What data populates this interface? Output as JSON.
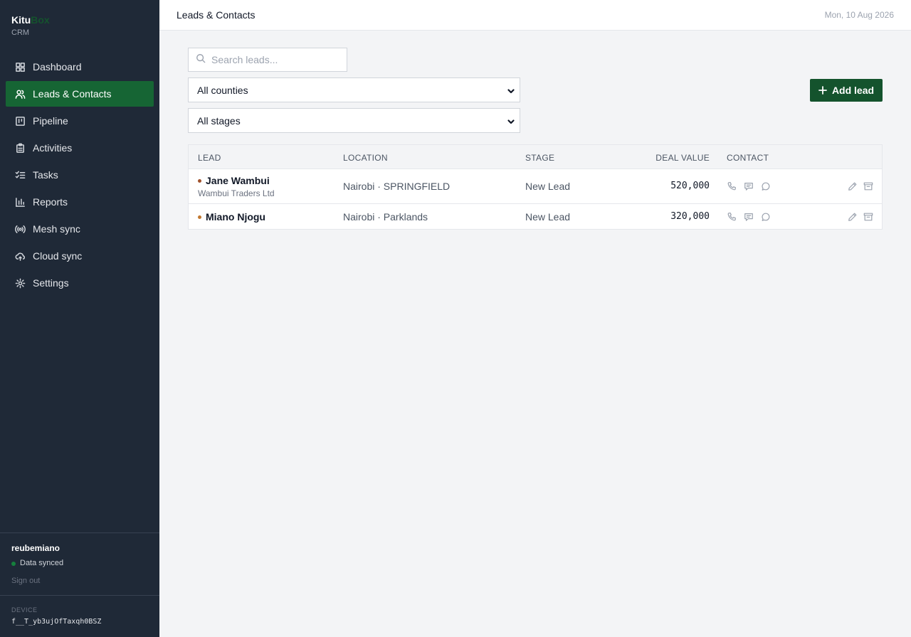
{
  "app": {
    "brand_part1": "Kitu",
    "brand_part2": "Box",
    "brand_sub": "CRM"
  },
  "sidebar": {
    "items": [
      {
        "label": "Dashboard",
        "icon": "grid-icon"
      },
      {
        "label": "Leads & Contacts",
        "icon": "users-icon",
        "active": true
      },
      {
        "label": "Pipeline",
        "icon": "kanban-icon"
      },
      {
        "label": "Activities",
        "icon": "clipboard-icon"
      },
      {
        "label": "Tasks",
        "icon": "checklist-icon"
      },
      {
        "label": "Reports",
        "icon": "bar-chart-icon"
      },
      {
        "label": "Mesh sync",
        "icon": "broadcast-icon"
      },
      {
        "label": "Cloud sync",
        "icon": "cloud-sync-icon"
      },
      {
        "label": "Settings",
        "icon": "gear-icon"
      }
    ],
    "user": {
      "name": "reubemiano",
      "status": "Data synced",
      "sign_out": "Sign out"
    },
    "device": {
      "label": "DEVICE",
      "id": "f__T_yb3ujOfTaxqh0BSZ"
    }
  },
  "header": {
    "title": "Leads & Contacts",
    "date": "Mon, 10 Aug 2026"
  },
  "filters": {
    "search_placeholder": "Search leads...",
    "county_selected": "All counties",
    "stage_selected": "All stages",
    "add_lead_label": "Add lead"
  },
  "table": {
    "columns": [
      "LEAD",
      "LOCATION",
      "STAGE",
      "DEAL VALUE",
      "CONTACT"
    ],
    "rows": [
      {
        "name": "Jane Wambui",
        "company": "Wambui Traders Ltd",
        "location": "Nairobi · SPRINGFIELD",
        "stage": "New Lead",
        "deal_value": "520,000",
        "dot_color": "#a0522d"
      },
      {
        "name": "Miano Njogu",
        "company": "",
        "location": "Nairobi · Parklands",
        "stage": "New Lead",
        "deal_value": "320,000",
        "dot_color": "#c2782f"
      }
    ]
  },
  "colors": {
    "sidebar_bg": "#1f2937",
    "accent": "#166534",
    "button": "#14532d"
  }
}
